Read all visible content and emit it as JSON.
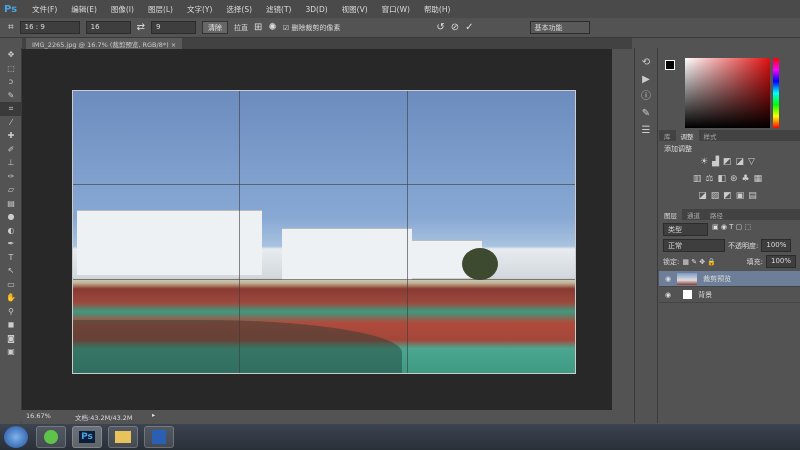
{
  "menubar": {
    "logo": "Ps",
    "items": [
      "文件(F)",
      "编辑(E)",
      "图像(I)",
      "图层(L)",
      "文字(Y)",
      "选择(S)",
      "滤镜(T)",
      "3D(D)",
      "视图(V)",
      "窗口(W)",
      "帮助(H)"
    ]
  },
  "options": {
    "ratio": "16 : 9",
    "width": "16",
    "height": "9",
    "clear_label": "清除",
    "straighten_label": "拉直",
    "delete_cropped_label": "删除裁剪的像素",
    "workspace": "基本功能"
  },
  "document": {
    "tab_title": "IMG_2265.jpg @ 16.7% (裁剪预览, RGB/8*)",
    "zoom": "16.67%",
    "doc_size": "文档:43.2M/43.2M"
  },
  "panels": {
    "top_tabs": [
      "库",
      "调整",
      "样式"
    ],
    "adjust_title": "添加调整",
    "layer_tabs": [
      "图层",
      "通道",
      "路径"
    ],
    "filter_kind": "类型",
    "blend_mode": "正常",
    "opacity_label": "不透明度:",
    "opacity": "100%",
    "lock_label": "锁定:",
    "fill_label": "填充:",
    "fill": "100%",
    "layers": [
      {
        "name": "裁剪预览",
        "selected": true
      },
      {
        "name": "背景",
        "selected": false
      }
    ]
  },
  "taskbar": {
    "apps": [
      "chrome-icon",
      "photoshop-icon",
      "folder-icon",
      "word-icon"
    ],
    "ps_label": "Ps"
  }
}
